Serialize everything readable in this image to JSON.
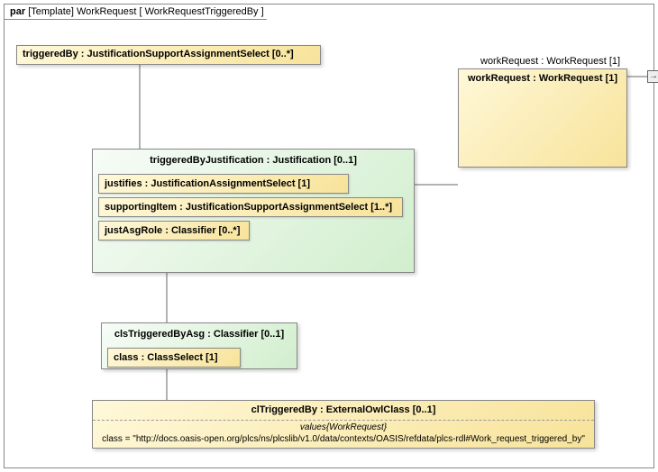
{
  "frame": {
    "kind": "par",
    "context": "[Template] WorkRequest",
    "name": "[ WorkRequestTriggeredBy ]"
  },
  "triggeredBy": {
    "title": "triggeredBy : JustificationSupportAssignmentSelect [0..*]"
  },
  "workRequest": {
    "extLabel": "workRequest : WorkRequest [1]",
    "title": "workRequest : WorkRequest [1]"
  },
  "justification": {
    "title": "triggeredByJustification : Justification [0..1]",
    "justifies": "justifies : JustificationAssignmentSelect [1]",
    "supportingItem": "supportingItem : JustificationSupportAssignmentSelect [1..*]",
    "justAsgRole": "justAsgRole : Classifier [0..*]"
  },
  "clsTriggeredByAsg": {
    "title": "clsTriggeredByAsg : Classifier [0..1]",
    "classField": "class : ClassSelect [1]"
  },
  "clTriggeredBy": {
    "title": "clTriggeredBy : ExternalOwlClass [0..1]",
    "valuesCaption": "values{WorkRequest}",
    "classValue": "class = \"http://docs.oasis-open.org/plcs/ns/plcslib/v1.0/data/contexts/OASIS/refdata/plcs-rdl#Work_request_triggered_by\""
  },
  "portGlyph": "→"
}
